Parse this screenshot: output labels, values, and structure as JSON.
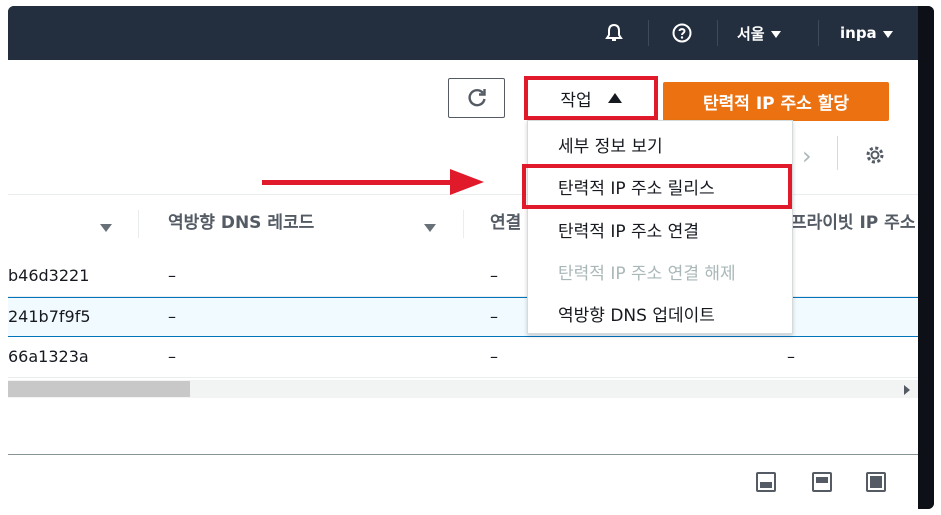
{
  "topnav": {
    "region": "서울",
    "user": "inpa"
  },
  "toolbar": {
    "actions_label": "작업",
    "allocate_label": "탄력적 IP 주소 할당"
  },
  "columns": {
    "reverse_dns": "역방향 DNS 레코드",
    "association": "연결",
    "private_ip": "프라이빗 IP 주소"
  },
  "rows": [
    {
      "id_tail": "b46d3221",
      "reverse_dns": "–",
      "association": "–",
      "private_ip": ""
    },
    {
      "id_tail": "241b7f9f5",
      "reverse_dns": "–",
      "association": "–",
      "private_ip": ""
    },
    {
      "id_tail": "66a1323a",
      "reverse_dns": "–",
      "association": "–",
      "private_ip": "–"
    }
  ],
  "menu": {
    "items": [
      {
        "label": "세부 정보 보기",
        "disabled": false
      },
      {
        "label": "탄력적 IP 주소 릴리스",
        "disabled": false
      },
      {
        "label": "탄력적 IP 주소 연결",
        "disabled": false
      },
      {
        "label": "탄력적 IP 주소 연결 해제",
        "disabled": true
      },
      {
        "label": "역방향 DNS 업데이트",
        "disabled": false
      }
    ]
  },
  "colors": {
    "primary_orange": "#ec7211",
    "annotation_red": "#e0192b",
    "nav_bg": "#232f3e",
    "selected_row_border": "#0073bb"
  }
}
